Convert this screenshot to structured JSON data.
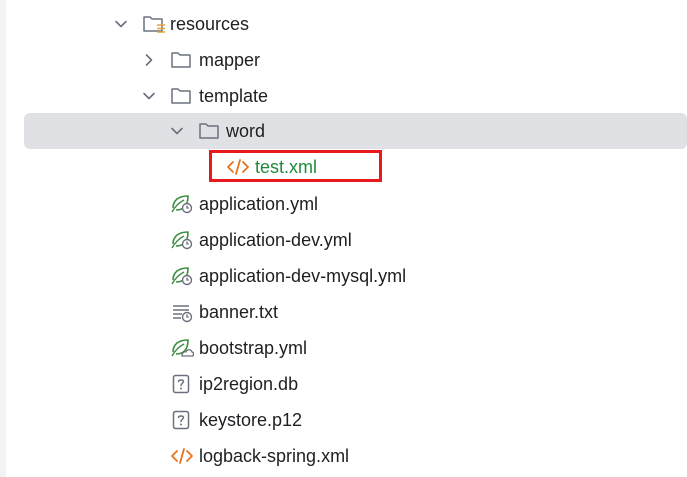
{
  "tree": {
    "items": [
      {
        "label": "resources",
        "icon": "resources-folder-icon",
        "expanded": true
      },
      {
        "label": "mapper",
        "icon": "folder-icon",
        "expanded": false
      },
      {
        "label": "template",
        "icon": "folder-icon",
        "expanded": true
      },
      {
        "label": "word",
        "icon": "folder-icon",
        "expanded": true,
        "selected": true
      },
      {
        "label": "test.xml",
        "icon": "xml-file-icon",
        "highlighted": true
      },
      {
        "label": "application.yml",
        "icon": "spring-config-icon"
      },
      {
        "label": "application-dev.yml",
        "icon": "spring-config-icon"
      },
      {
        "label": "application-dev-mysql.yml",
        "icon": "spring-config-icon"
      },
      {
        "label": "banner.txt",
        "icon": "text-file-icon"
      },
      {
        "label": "bootstrap.yml",
        "icon": "spring-bootstrap-icon"
      },
      {
        "label": "ip2region.db",
        "icon": "unknown-file-icon"
      },
      {
        "label": "keystore.p12",
        "icon": "unknown-file-icon"
      },
      {
        "label": "logback-spring.xml",
        "icon": "xml-file-icon"
      }
    ]
  },
  "colors": {
    "selection_bg": "#dfe1e5",
    "highlight_border": "#e8191c",
    "vcs_added_text": "#208a3c",
    "xml_icon": "#e8731e",
    "spring_icon": "#3b8e3f"
  }
}
